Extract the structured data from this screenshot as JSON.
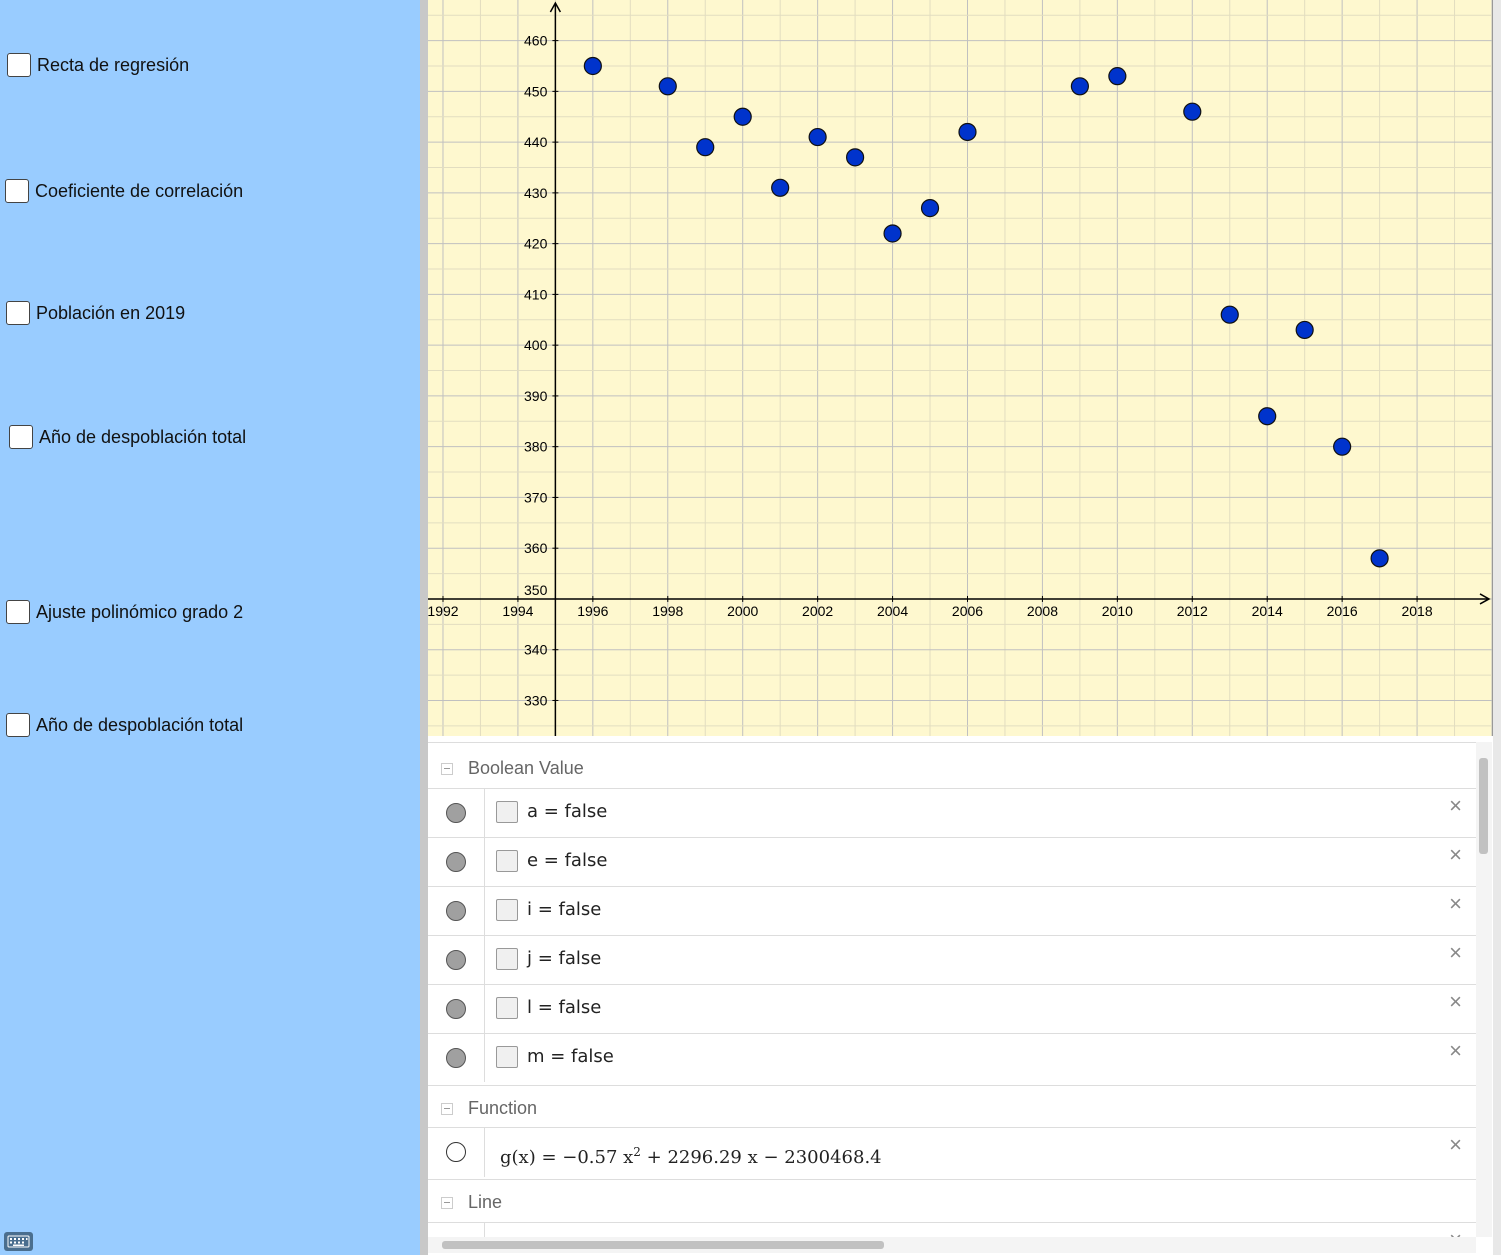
{
  "left_panel": {
    "checkboxes": [
      {
        "label": "Recta de regresión",
        "checked": false
      },
      {
        "label": "Coeficiente de correlación",
        "checked": false
      },
      {
        "label": "Población en 2019",
        "checked": false
      },
      {
        "label": "Año de despoblación total",
        "checked": false
      },
      {
        "label": "Ajuste polinómico grado 2",
        "checked": false
      },
      {
        "label": "Año de despoblación total",
        "checked": false
      }
    ],
    "keyboard_icon": "keyboard-icon"
  },
  "chart_data": {
    "type": "scatter",
    "title": "",
    "xlabel": "",
    "ylabel": "",
    "xlim": [
      1991.6,
      2020
    ],
    "ylim": [
      323,
      468
    ],
    "x_axis_at_y": 350,
    "y_axis_at_x": 1995,
    "grid": true,
    "background": "#fef8cf",
    "point_color": "#0033cc",
    "x_ticks": [
      1992,
      1994,
      1996,
      1998,
      2000,
      2002,
      2004,
      2006,
      2008,
      2010,
      2012,
      2014,
      2016,
      2018
    ],
    "y_ticks": [
      330,
      340,
      350,
      360,
      370,
      380,
      390,
      400,
      410,
      420,
      430,
      440,
      450,
      460
    ],
    "x": [
      1996,
      1998,
      1999,
      2000,
      2001,
      2002,
      2003,
      2004,
      2005,
      2006,
      2009,
      2010,
      2012,
      2013,
      2014,
      2015,
      2016,
      2017
    ],
    "y": [
      455,
      451,
      439,
      445,
      431,
      441,
      437,
      422,
      427,
      442,
      451,
      453,
      446,
      406,
      386,
      403,
      380,
      358
    ]
  },
  "algebra": {
    "groups": [
      {
        "title": "Boolean Value",
        "items": [
          {
            "expr": "a = false",
            "visible": true
          },
          {
            "expr": "e = false",
            "visible": true
          },
          {
            "expr": "i = false",
            "visible": true
          },
          {
            "expr": "j = false",
            "visible": true
          },
          {
            "expr": "l = false",
            "visible": true
          },
          {
            "expr": "m = false",
            "visible": true
          }
        ]
      },
      {
        "title": "Function",
        "items": [
          {
            "expr_lhs": "g(x) = −0.57 x",
            "expr_sup": "2",
            "expr_rhs": " + 2296.29 x − 2300468.4",
            "visible": false
          }
        ]
      },
      {
        "title": "Line",
        "items": []
      }
    ],
    "close_glyph": "×"
  }
}
